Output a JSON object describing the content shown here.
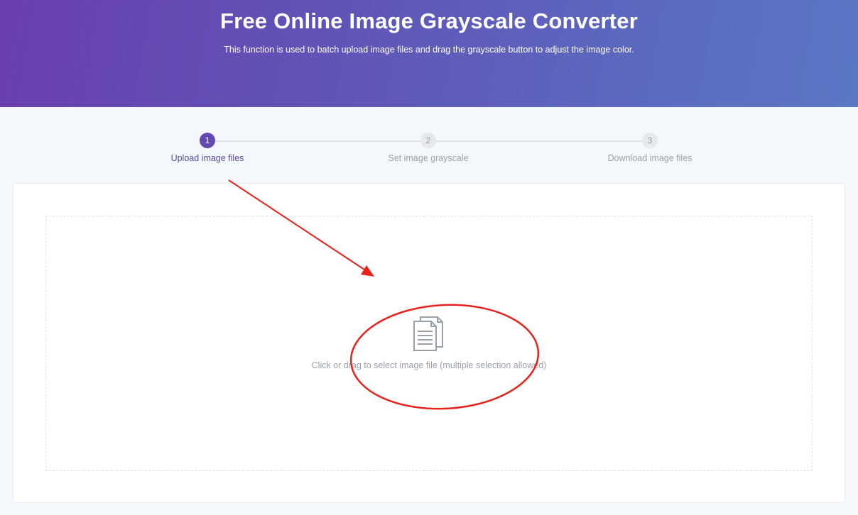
{
  "header": {
    "title": "Free Online Image Grayscale Converter",
    "subtitle": "This function is used to batch upload image files and drag the grayscale button to adjust the image color."
  },
  "steps": [
    {
      "number": "1",
      "label": "Upload image files",
      "active": true
    },
    {
      "number": "2",
      "label": "Set image grayscale",
      "active": false
    },
    {
      "number": "3",
      "label": "Download image files",
      "active": false
    }
  ],
  "upload": {
    "icon": "document-icon",
    "text": "Click or drag to select image file (multiple selection allowed)"
  },
  "colors": {
    "accent": "#6347b3",
    "annotation": "#e8221b"
  }
}
